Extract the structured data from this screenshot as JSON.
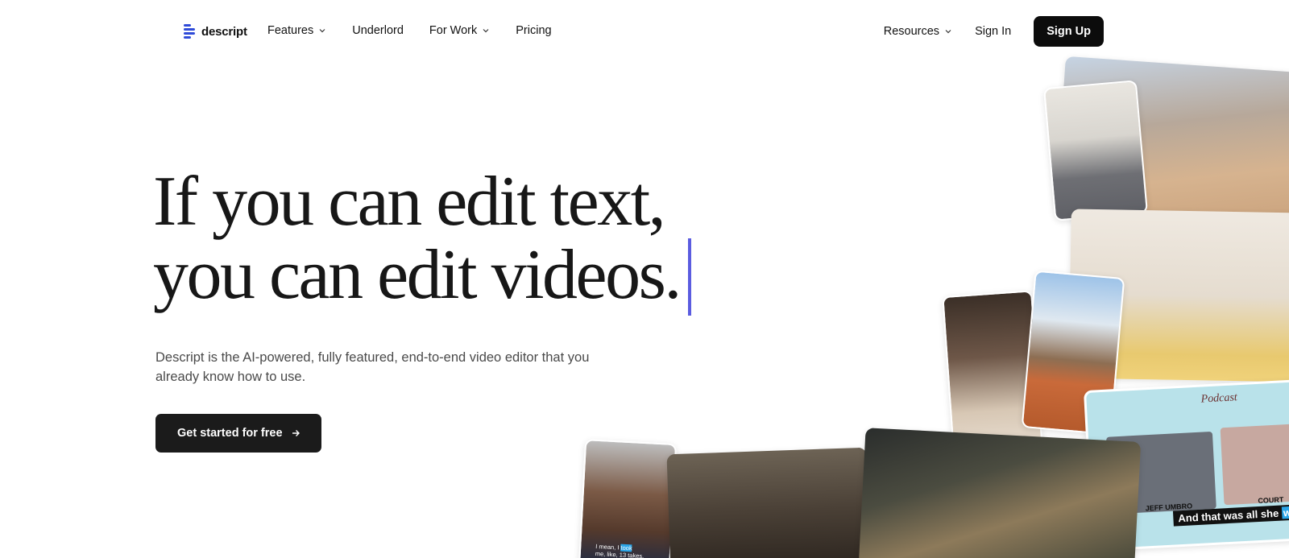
{
  "brand": {
    "name": "descript",
    "accent": "#5b5ce0"
  },
  "nav": {
    "links": [
      {
        "label": "Features",
        "dropdown": true
      },
      {
        "label": "Underlord",
        "dropdown": false
      },
      {
        "label": "For Work",
        "dropdown": true
      },
      {
        "label": "Pricing",
        "dropdown": false
      }
    ],
    "resources_label": "Resources",
    "signin_label": "Sign In",
    "signup_label": "Sign Up"
  },
  "hero": {
    "headline_line1": "If you can edit text,",
    "headline_line2": "you can edit videos.",
    "subhead": "Descript is the AI-powered, fully featured, end-to-end video editor that you already know how to use.",
    "cta_label": "Get started for free"
  },
  "collage": {
    "podcast_title": "Podcast",
    "podcast_name_left": "JEFF UMBRO",
    "podcast_name_right": "COURT",
    "caption_pre": "And that was all she",
    "caption_highlight": "wrote",
    "portrait_caption_pre": "I mean, I",
    "portrait_caption_highlight": "took",
    "portrait_caption_post": "me, like, 13 takes."
  }
}
